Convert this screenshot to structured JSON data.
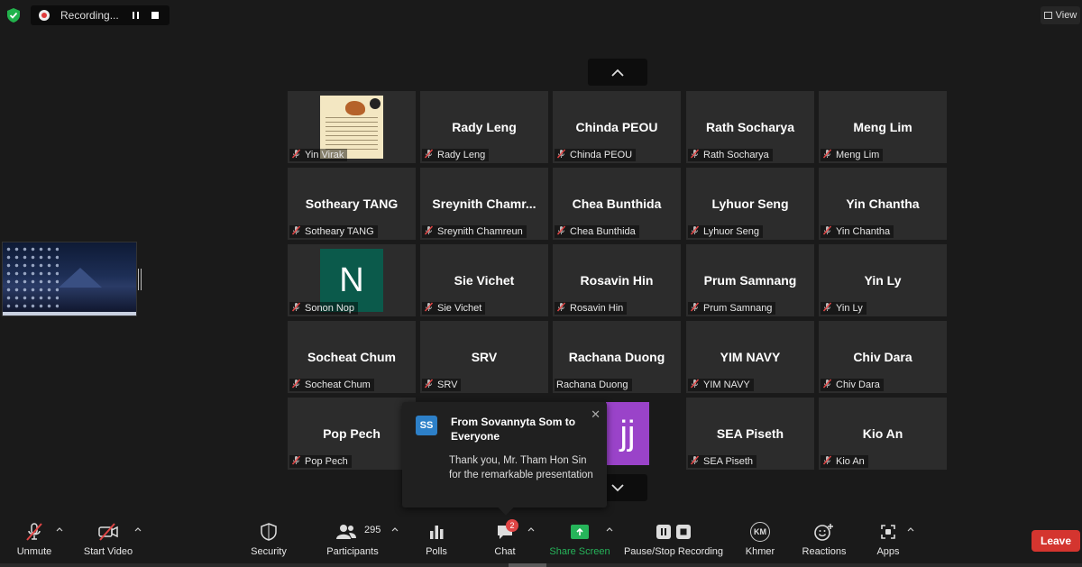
{
  "recording": {
    "text": "Recording..."
  },
  "view": {
    "label": "View"
  },
  "tiles": [
    {
      "display": "",
      "label": "Yin Virak",
      "kind": "photo"
    },
    {
      "display": "Rady Leng",
      "label": "Rady Leng",
      "kind": "name"
    },
    {
      "display": "Chinda PEOU",
      "label": "Chinda PEOU",
      "kind": "name"
    },
    {
      "display": "Rath Socharya",
      "label": "Rath Socharya",
      "kind": "name"
    },
    {
      "display": "Meng Lim",
      "label": "Meng Lim",
      "kind": "name"
    },
    {
      "display": "Sotheary TANG",
      "label": "Sotheary TANG",
      "kind": "name"
    },
    {
      "display": "Sreynith  Chamr...",
      "label": "Sreynith Chamreun",
      "kind": "name"
    },
    {
      "display": "Chea Bunthida",
      "label": "Chea Bunthida",
      "kind": "name"
    },
    {
      "display": "Lyhuor Seng",
      "label": "Lyhuor Seng",
      "kind": "name"
    },
    {
      "display": "Yin Chantha",
      "label": "Yin Chantha",
      "kind": "name"
    },
    {
      "display": "N",
      "label": "Sonon Nop",
      "kind": "avatar-n"
    },
    {
      "display": "Sie Vichet",
      "label": "Sie Vichet",
      "kind": "name"
    },
    {
      "display": "Rosavin Hin",
      "label": "Rosavin Hin",
      "kind": "name"
    },
    {
      "display": "Prum Samnang",
      "label": "Prum Samnang",
      "kind": "name"
    },
    {
      "display": "Yin Ly",
      "label": "Yin Ly",
      "kind": "name"
    },
    {
      "display": "Socheat Chum",
      "label": "Socheat Chum",
      "kind": "name"
    },
    {
      "display": "SRV",
      "label": "SRV",
      "kind": "name"
    },
    {
      "display": "Rachana Duong",
      "label": "Rachana Duong",
      "kind": "name",
      "unmuted": true
    },
    {
      "display": "YIM NAVY",
      "label": "YIM NAVY",
      "kind": "name"
    },
    {
      "display": "Chiv Dara",
      "label": "Chiv Dara",
      "kind": "name"
    },
    {
      "display": "Pop Pech",
      "label": "Pop Pech",
      "kind": "name"
    },
    {
      "display": "",
      "label": "",
      "kind": "hidden"
    },
    {
      "display": "jj",
      "label": "",
      "kind": "avatar-jj"
    },
    {
      "display": "SEA Piseth",
      "label": "SEA Piseth",
      "kind": "name"
    },
    {
      "display": "Kio An",
      "label": "Kio An",
      "kind": "name"
    }
  ],
  "chat_toast": {
    "initials": "SS",
    "from": "From Sovannyta Som to Everyone",
    "message": "Thank you, Mr. Tham Hon Sin for the remarkable presentation"
  },
  "toolbar": {
    "unmute": "Unmute",
    "start_video": "Start Video",
    "security": "Security",
    "participants": "Participants",
    "participants_count": "295",
    "polls": "Polls",
    "chat": "Chat",
    "chat_badge": "2",
    "share_screen": "Share Screen",
    "pause_stop_recording": "Pause/Stop Recording",
    "khmer": "Khmer",
    "khmer_initials": "KM",
    "reactions": "Reactions",
    "apps": "Apps",
    "leave": "Leave"
  },
  "colors": {
    "background": "#1a1a1a",
    "tile": "#2c2c2c",
    "leave": "#d4352f",
    "share": "#26b45a",
    "badge": "#e04545",
    "avatar_n": "#0b5a4b",
    "avatar_jj": "#9a43c9"
  }
}
